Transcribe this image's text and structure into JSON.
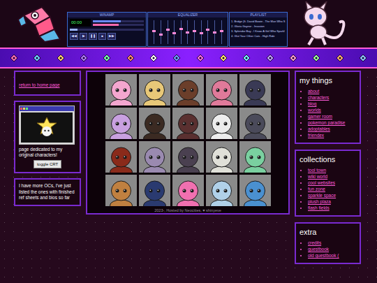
{
  "player": {
    "title": "WINAMP",
    "time": "00:00",
    "volume": 0.55,
    "balance": 0.5,
    "seek": 0.1,
    "controls": [
      "◀◀",
      "▶",
      "❚❚",
      "■",
      "▶▶"
    ]
  },
  "equalizer": {
    "title": "EQUALIZER",
    "bands": [
      0.5,
      0.35,
      0.55,
      0.4,
      0.6,
      0.45,
      0.5,
      0.4,
      0.55,
      0.45,
      0.5
    ]
  },
  "playlist": {
    "title": "PLAYLIST",
    "tracks": [
      "1. Bridge (ft. David Bowie - The Man Who S",
      "2. Gloria Gaynor - Invasion",
      "3. Splendor Bay - I Know A Girl Who Sparkl",
      "4. Glut Your Other Cats - High Ride"
    ]
  },
  "left": {
    "return_link": "return to home page",
    "crt": {
      "caption": "page dedicated to my original characters!",
      "button": "toggle CRT"
    },
    "note": "I have more OCs, I've just listed the ones with finished ref sheets and bios so far"
  },
  "portraits": [
    {
      "color": "#f3a6cf"
    },
    {
      "color": "#e8c878"
    },
    {
      "color": "#6b3e2a"
    },
    {
      "color": "#e07a9a"
    },
    {
      "color": "#3a3a55"
    },
    {
      "color": "#c8a0e0"
    },
    {
      "color": "#3b2a22"
    },
    {
      "color": "#5a3030"
    },
    {
      "color": "#ececec"
    },
    {
      "color": "#4a4a5a"
    },
    {
      "color": "#8a2a1a"
    },
    {
      "color": "#9a8ab0"
    },
    {
      "color": "#4a4050"
    },
    {
      "color": "#e0e0d8"
    },
    {
      "color": "#7ad0a0"
    },
    {
      "color": "#c08040"
    },
    {
      "color": "#2a3a70"
    },
    {
      "color": "#f070b0"
    },
    {
      "color": "#b0d0e8"
    },
    {
      "color": "#4a90d0"
    }
  ],
  "footer": "2023-, Hosted by Neocities, ♥ shinyeve",
  "sections": [
    {
      "title": "my things",
      "links": [
        "about",
        "characters",
        "blog",
        "worlds",
        "gamer room",
        "pokemon paradise",
        "adoptables",
        "friendex"
      ]
    },
    {
      "title": "collections",
      "links": [
        "tool town",
        "wiki world",
        "cool websites",
        "fun zone",
        "sparkle space",
        "plush plaza",
        "flash fields"
      ]
    },
    {
      "title": "extra",
      "links": [
        "credits",
        "guestbook",
        "old guestbook ("
      ]
    }
  ]
}
